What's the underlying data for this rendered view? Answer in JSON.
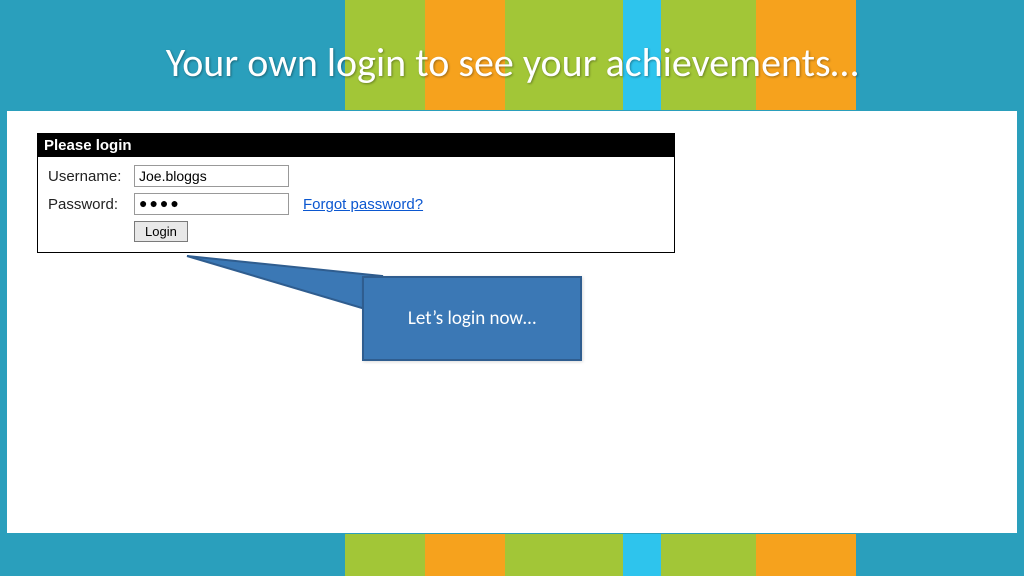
{
  "slide": {
    "title": "Your own login to see your achievements…"
  },
  "login_panel": {
    "header": "Please login",
    "username_label": "Username:",
    "username_value": "Joe.bloggs",
    "password_label": "Password:",
    "password_display": "●●●●",
    "forgot_link": "Forgot password?",
    "login_button": "Login"
  },
  "callout": {
    "text": "Let’s login now…"
  },
  "colors": {
    "teal": "#2a9fbc",
    "green": "#a2c637",
    "orange": "#f6a21d",
    "cyan": "#2ec4ed",
    "callout_fill": "#3b78b5",
    "callout_border": "#2f5d8f"
  }
}
